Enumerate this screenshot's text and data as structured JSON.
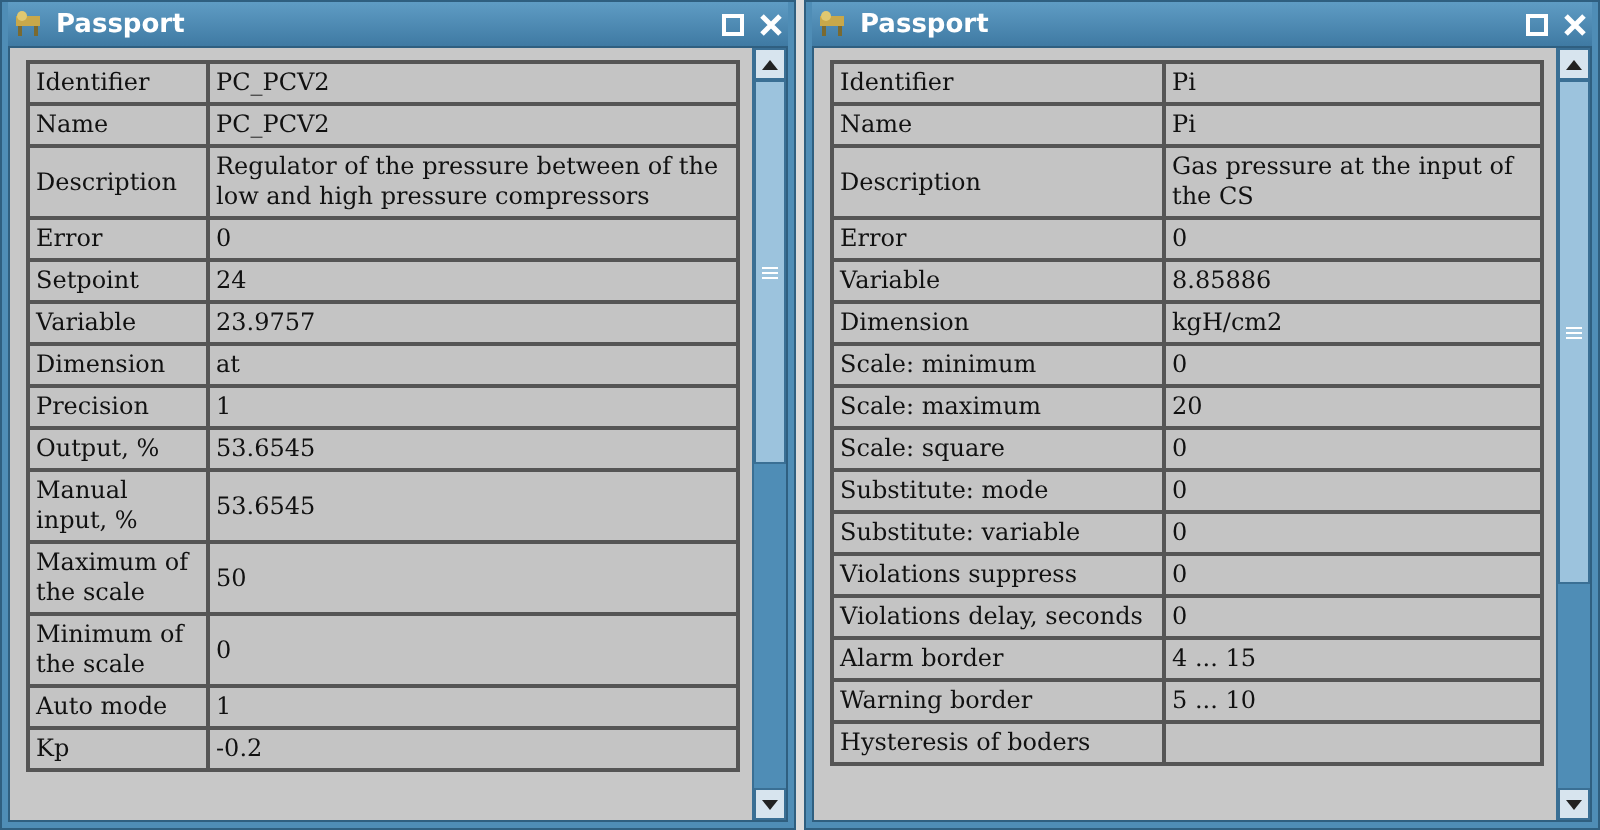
{
  "windows": [
    {
      "title": "Passport",
      "rows": [
        {
          "label": "Identifier",
          "value": "PC_PCV2"
        },
        {
          "label": "Name",
          "value": "PC_PCV2"
        },
        {
          "label": "Description",
          "value": "Regulator of the pressure between of the low and high pressure compressors"
        },
        {
          "label": "Error",
          "value": "0"
        },
        {
          "label": "Setpoint",
          "value": "24"
        },
        {
          "label": "Variable",
          "value": "23.9757"
        },
        {
          "label": "Dimension",
          "value": "at"
        },
        {
          "label": "Precision",
          "value": "1"
        },
        {
          "label": "Output, %",
          "value": "53.6545"
        },
        {
          "label": "Manual input, %",
          "value": "53.6545"
        },
        {
          "label": "Maximum of the scale",
          "value": "50"
        },
        {
          "label": "Minimum of the scale",
          "value": "0"
        },
        {
          "label": "Auto mode",
          "value": "1"
        },
        {
          "label": "Kp",
          "value": "-0.2"
        }
      ]
    },
    {
      "title": "Passport",
      "rows": [
        {
          "label": "Identifier",
          "value": "Pi"
        },
        {
          "label": "Name",
          "value": "Pi"
        },
        {
          "label": "Description",
          "value": "Gas pressure at the input of the CS"
        },
        {
          "label": "Error",
          "value": "0"
        },
        {
          "label": "Variable",
          "value": "8.85886"
        },
        {
          "label": "Dimension",
          "value": "kgH/cm2"
        },
        {
          "label": "Scale: minimum",
          "value": "0"
        },
        {
          "label": "Scale: maximum",
          "value": "20"
        },
        {
          "label": "Scale: square",
          "value": "0"
        },
        {
          "label": "Substitute: mode",
          "value": "0"
        },
        {
          "label": "Substitute: variable",
          "value": "0"
        },
        {
          "label": "Violations suppress",
          "value": "0"
        },
        {
          "label": "Violations delay, seconds",
          "value": "0"
        },
        {
          "label": "Alarm border",
          "value": "4 ... 15"
        },
        {
          "label": "Warning border",
          "value": "5 ... 10"
        },
        {
          "label": "Hysteresis of boders"
        }
      ]
    }
  ]
}
